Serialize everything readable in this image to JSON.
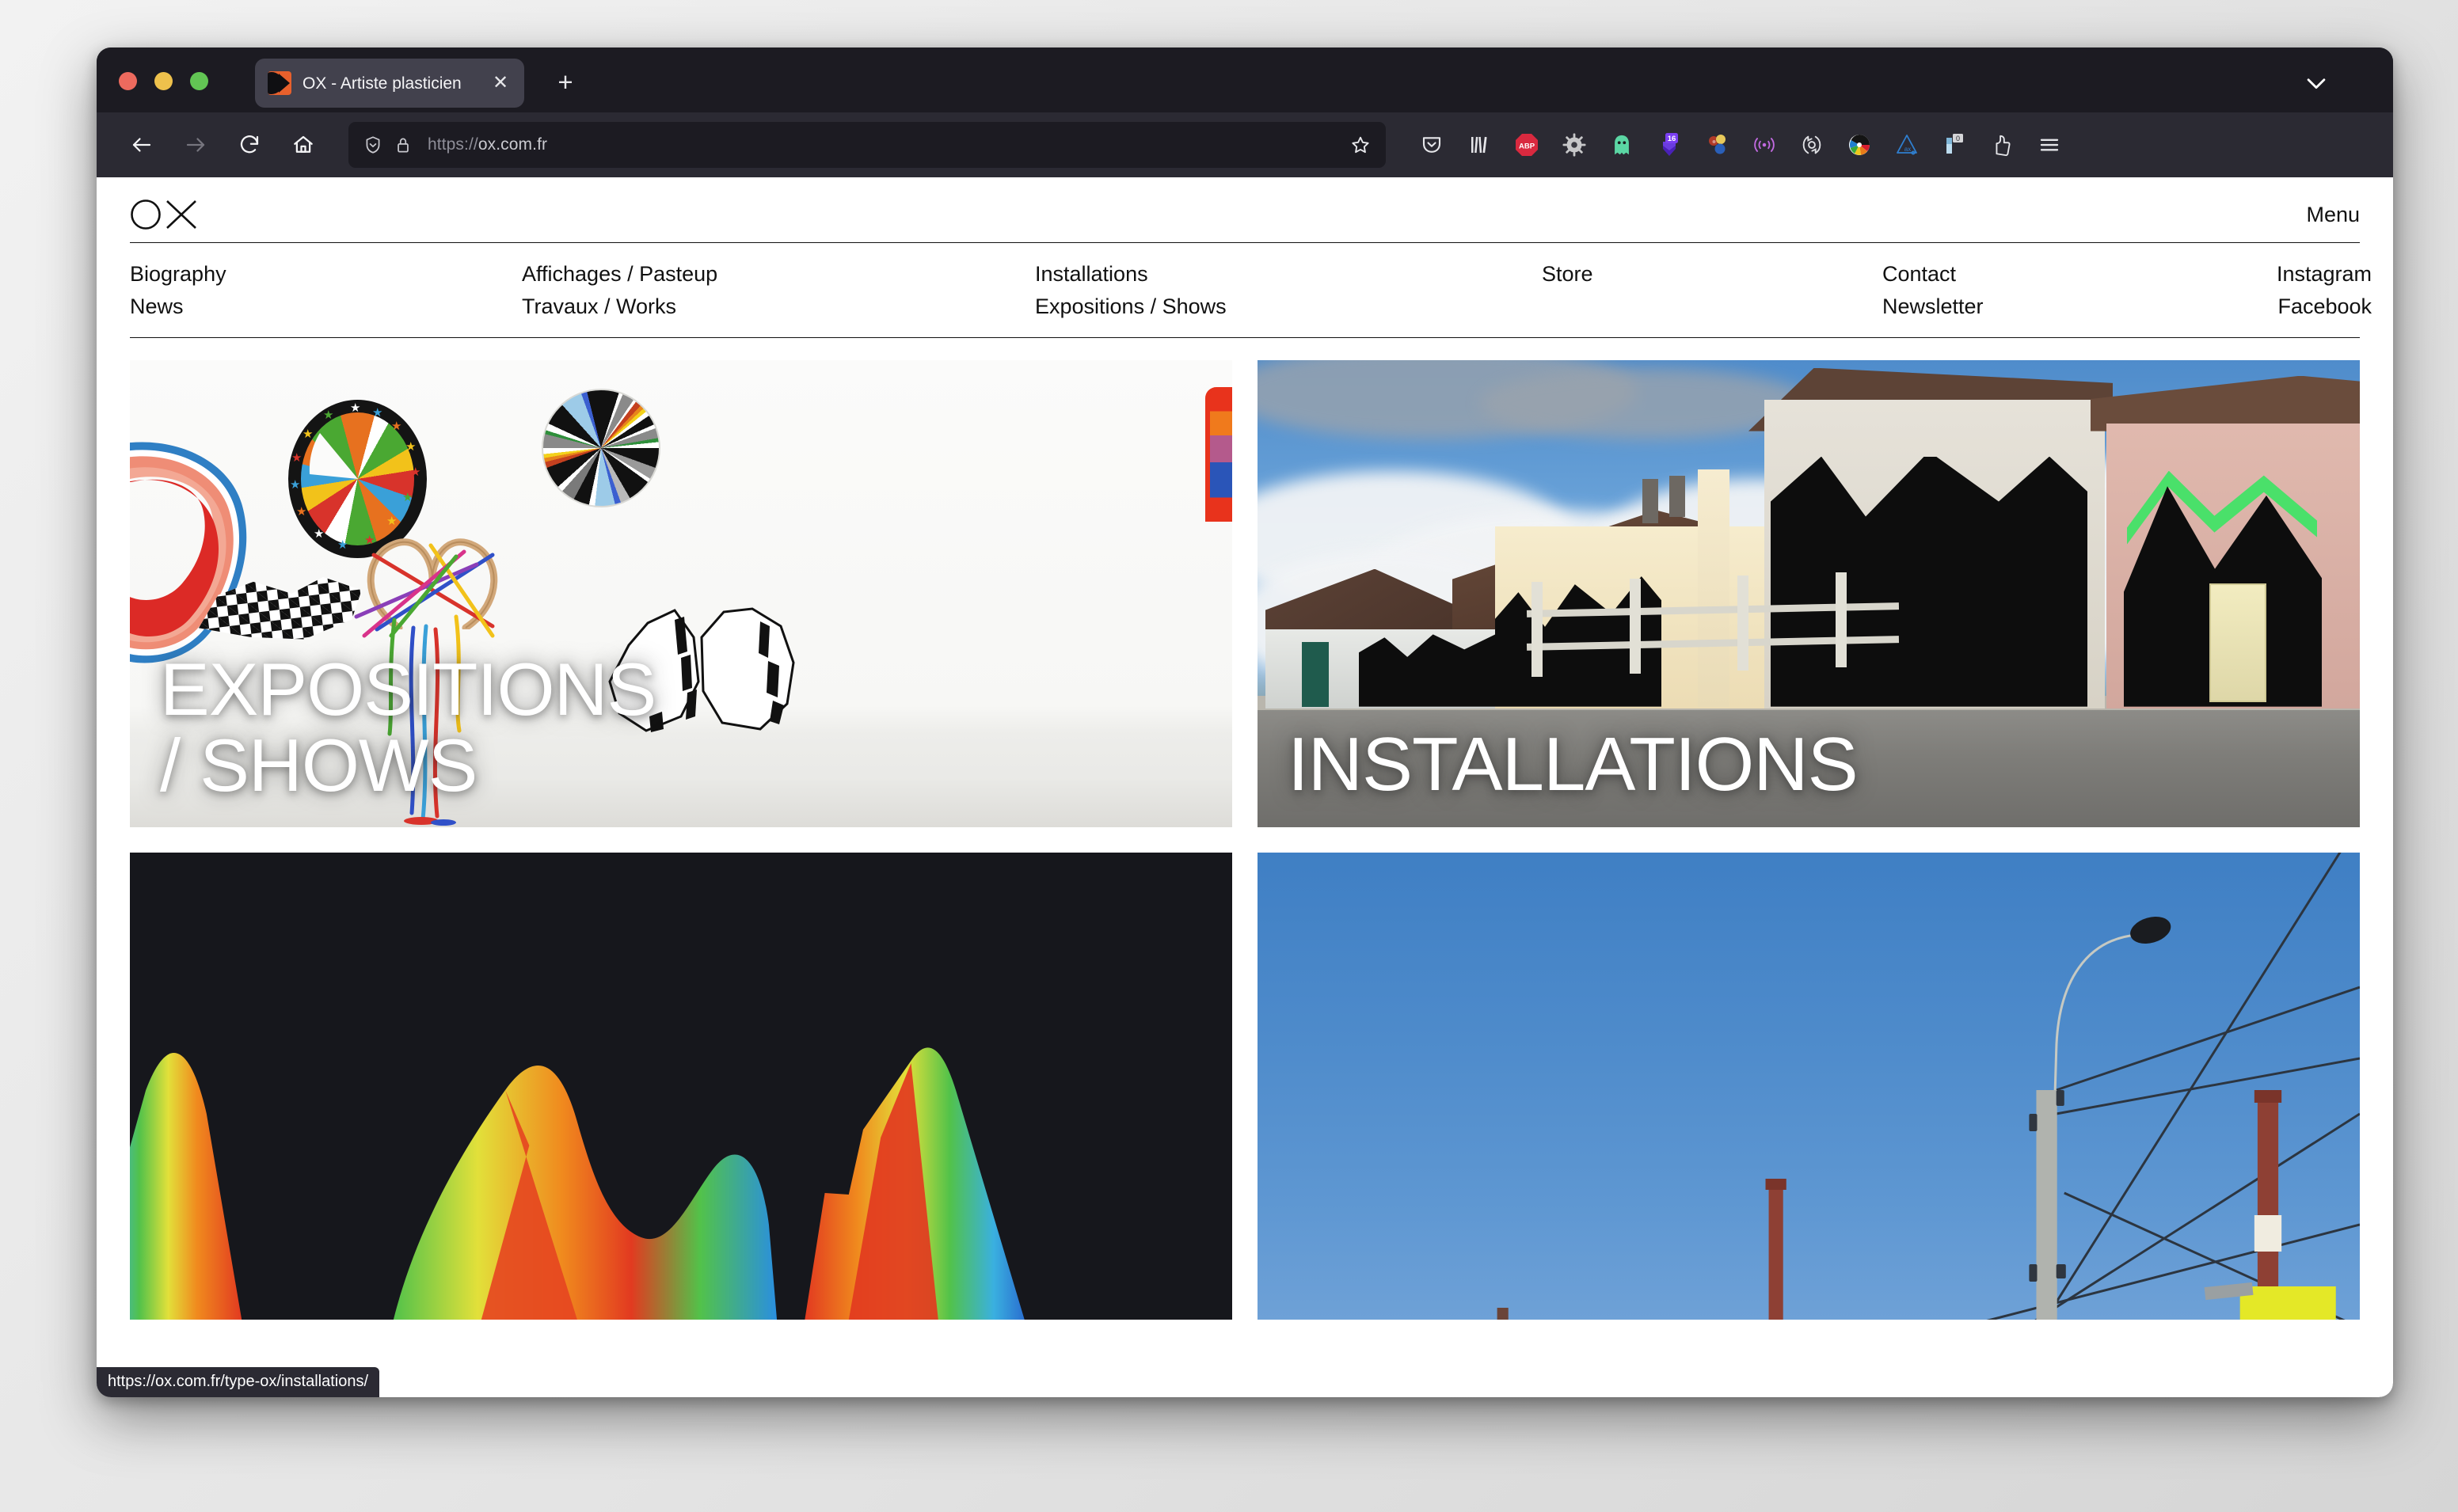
{
  "browser": {
    "window_controls": [
      "close",
      "minimize",
      "maximize"
    ],
    "tab": {
      "title": "OX - Artiste plasticien",
      "favicon_name": "ox-favicon",
      "close_label": "✕"
    },
    "new_tab_label": "+",
    "toolbar": {
      "back_label": "back",
      "forward_label": "forward",
      "reload_label": "reload",
      "home_label": "home"
    },
    "urlbar": {
      "scheme": "https://",
      "host": "ox.com.fr",
      "full_url": "https://ox.com.fr",
      "shield_icon": "tracking-protection-shield",
      "lock_icon": "padlock",
      "bookmark_icon": "star-outline"
    },
    "extensions": [
      {
        "name": "pocket-icon",
        "badge": ""
      },
      {
        "name": "library-icon",
        "badge": ""
      },
      {
        "name": "adblock-plus-icon",
        "label": "ABP",
        "badge": ""
      },
      {
        "name": "gear-settings-icon",
        "badge": ""
      },
      {
        "name": "ghostery-icon",
        "badge": ""
      },
      {
        "name": "purple-shield-icon",
        "badge": "16"
      },
      {
        "name": "colorzilla-icon",
        "badge": ""
      },
      {
        "name": "wifi-signal-icon",
        "badge": ""
      },
      {
        "name": "sync-icon",
        "badge": ""
      },
      {
        "name": "color-wheel-icon",
        "badge": ""
      },
      {
        "name": "axe-devtools-icon",
        "label": "ax",
        "badge": ""
      },
      {
        "name": "downloads-icon",
        "badge": "0"
      },
      {
        "name": "account-icon",
        "badge": ""
      },
      {
        "name": "hamburger-menu-icon",
        "badge": ""
      }
    ],
    "tab_list_chevron": "chevron-down",
    "status_link": "https://ox.com.fr/type-ox/installations/"
  },
  "site": {
    "logo_name": "ox-circle-x-logo",
    "menu_label": "Menu",
    "nav": {
      "col1": [
        "Biography",
        "News"
      ],
      "col2": [
        "Affichages / Pasteup",
        "Travaux / Works"
      ],
      "col3": [
        "Installations",
        "Expositions / Shows"
      ],
      "col4": [
        "Store"
      ],
      "col5": [
        "Contact",
        "Newsletter"
      ],
      "col6": [
        "Instagram",
        "Facebook"
      ]
    },
    "tiles": [
      {
        "name": "tile-expositions-shows",
        "caption": "EXPOSITIONS\n/ SHOWS",
        "image_alt": "Gallery wall with circular abstract artworks"
      },
      {
        "name": "tile-installations",
        "caption": "INSTALLATIONS",
        "image_alt": "Village houses painted with large black geometric shapes"
      },
      {
        "name": "tile-rainbow-peaks",
        "caption": "",
        "image_alt": "Rainbow gradient mountain peaks on black background"
      },
      {
        "name": "tile-sky-poles",
        "caption": "",
        "image_alt": "Blue sky with utility pole, wires and chimneys"
      }
    ]
  }
}
